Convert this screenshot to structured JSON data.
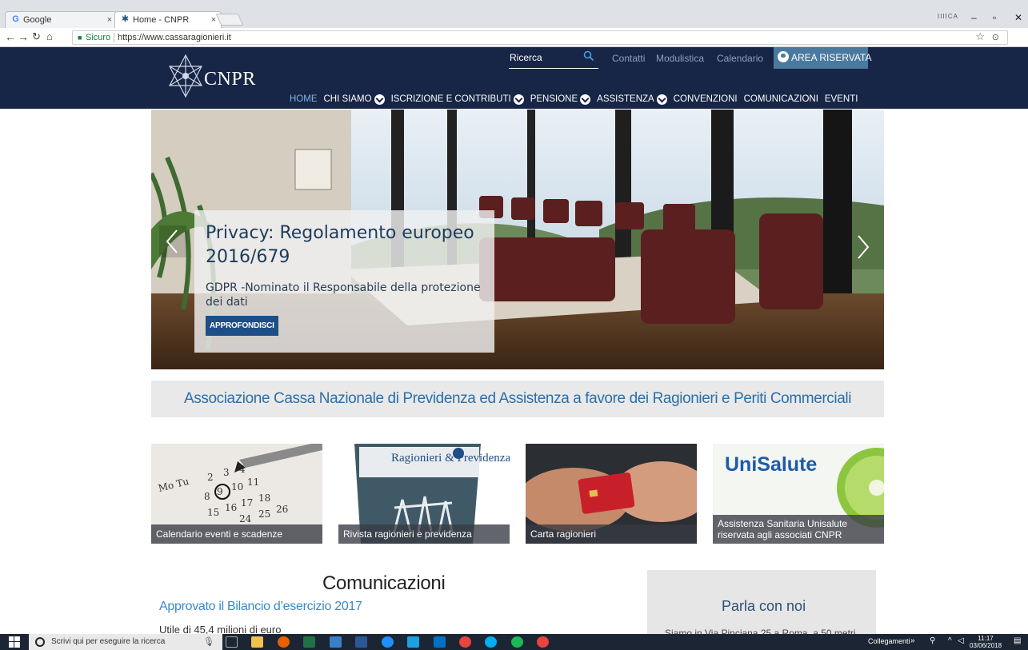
{
  "browser": {
    "tabs": [
      {
        "title": "Google",
        "favicon": "google-icon",
        "active": false
      },
      {
        "title": "Home - CNPR",
        "favicon": "cnpr-star-icon",
        "active": true
      }
    ],
    "close_glyph": "×",
    "security_label": "Sicuro",
    "url": "https://www.cassaragionieri.it",
    "profile_label": "IIIICA"
  },
  "header": {
    "logo_text": "CNPR",
    "search_placeholder": "Ricerca",
    "utility_links": [
      "Contatti",
      "Modulistica",
      "Calendario"
    ],
    "reserved_area_label": "AREA RISERVATA",
    "nav": [
      {
        "label": "HOME",
        "dropdown": false,
        "active": true
      },
      {
        "label": "CHI SIAMO",
        "dropdown": true,
        "active": false
      },
      {
        "label": "ISCRIZIONE E CONTRIBUTI",
        "dropdown": true,
        "active": false
      },
      {
        "label": "PENSIONE",
        "dropdown": true,
        "active": false
      },
      {
        "label": "ASSISTENZA",
        "dropdown": true,
        "active": false
      },
      {
        "label": "CONVENZIONI",
        "dropdown": false,
        "active": false
      },
      {
        "label": "COMUNICAZIONI",
        "dropdown": false,
        "active": false
      },
      {
        "label": "EVENTI",
        "dropdown": false,
        "active": false
      }
    ]
  },
  "hero": {
    "title": "Privacy: Regolamento europeo 2016/679",
    "text": "GDPR -Nominato il Responsabile della protezione dei dati",
    "button_label": "APPROFONDISCI"
  },
  "tagline": "Associazione Cassa Nazionale di Previdenza ed Assistenza a favore dei Ragionieri e Periti Commerciali",
  "cards": [
    {
      "label": "Calendario eventi e scadenze"
    },
    {
      "label": "Rivista ragionieri e previdenza",
      "image_title": "Ragionieri & Previdenza"
    },
    {
      "label": "Carta ragionieri"
    },
    {
      "label": "Assistenza Sanitaria Unisalute riservata agli associati CNPR",
      "brand": "UniSalute"
    }
  ],
  "comunicazioni": {
    "title": "Comunicazioni",
    "news_title": "Approvato il Bilancio d’esercizio 2017",
    "news_text": "Utile di 45,4 milioni di euro"
  },
  "contact": {
    "title": "Parla con noi",
    "text": "Siamo in Via Pinciana 25 a Roma, a 50 metri"
  },
  "taskbar": {
    "search_placeholder": "Scrivi qui per eseguire la ricerca",
    "tray_label": "Collegamenti",
    "time": "11:17",
    "date": "03/06/2018"
  },
  "colors": {
    "header_bg": "#172546",
    "reserved_area_bg": "#4a79a0",
    "accent_blue": "#3a87c8",
    "button_blue": "#1f4e86"
  }
}
